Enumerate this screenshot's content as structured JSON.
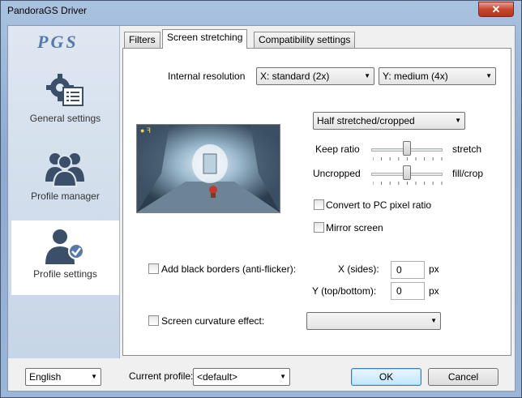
{
  "window": {
    "title": "PandoraGS Driver",
    "close_label": "✕"
  },
  "logo_text": "PGS",
  "sidebar": {
    "items": [
      {
        "label": "General settings",
        "icon": "gear-list-icon"
      },
      {
        "label": "Profile manager",
        "icon": "users-icon"
      },
      {
        "label": "Profile settings",
        "icon": "user-check-icon"
      }
    ],
    "active": "Profile settings"
  },
  "tabs": [
    {
      "label": "Filters"
    },
    {
      "label": "Screen stretching"
    },
    {
      "label": "Compatibility settings"
    }
  ],
  "screen_stretching": {
    "internal_resolution_label": "Internal resolution",
    "res_x": "X: standard (2x)",
    "res_y": "Y: medium (4x)",
    "stretch_mode": "Half stretched/cropped",
    "keep_ratio_label": "Keep ratio",
    "stretch_label": "stretch",
    "keep_ratio_value": 0.5,
    "uncropped_label": "Uncropped",
    "fillcrop_label": "fill/crop",
    "crop_value": 0.5,
    "convert_pc_ratio_label": "Convert to PC pixel ratio",
    "convert_pc_ratio_checked": false,
    "mirror_label": "Mirror screen",
    "mirror_checked": false,
    "black_borders_label": "Add black borders (anti-flicker):",
    "black_borders_checked": false,
    "x_sides_label": "X (sides):",
    "x_sides_value": "0",
    "y_topbottom_label": "Y (top/bottom):",
    "y_topbottom_value": "0",
    "px_unit": "px",
    "curvature_label": "Screen curvature effect:",
    "curvature_checked": false,
    "curvature_value": ""
  },
  "footer": {
    "language": "English",
    "current_profile_label": "Current profile:",
    "current_profile": "<default>",
    "ok_label": "OK",
    "cancel_label": "Cancel"
  },
  "colors": {
    "accent": "#3c7fb1",
    "close_red": "#c7462f",
    "window_frame": "#8eaacf"
  }
}
